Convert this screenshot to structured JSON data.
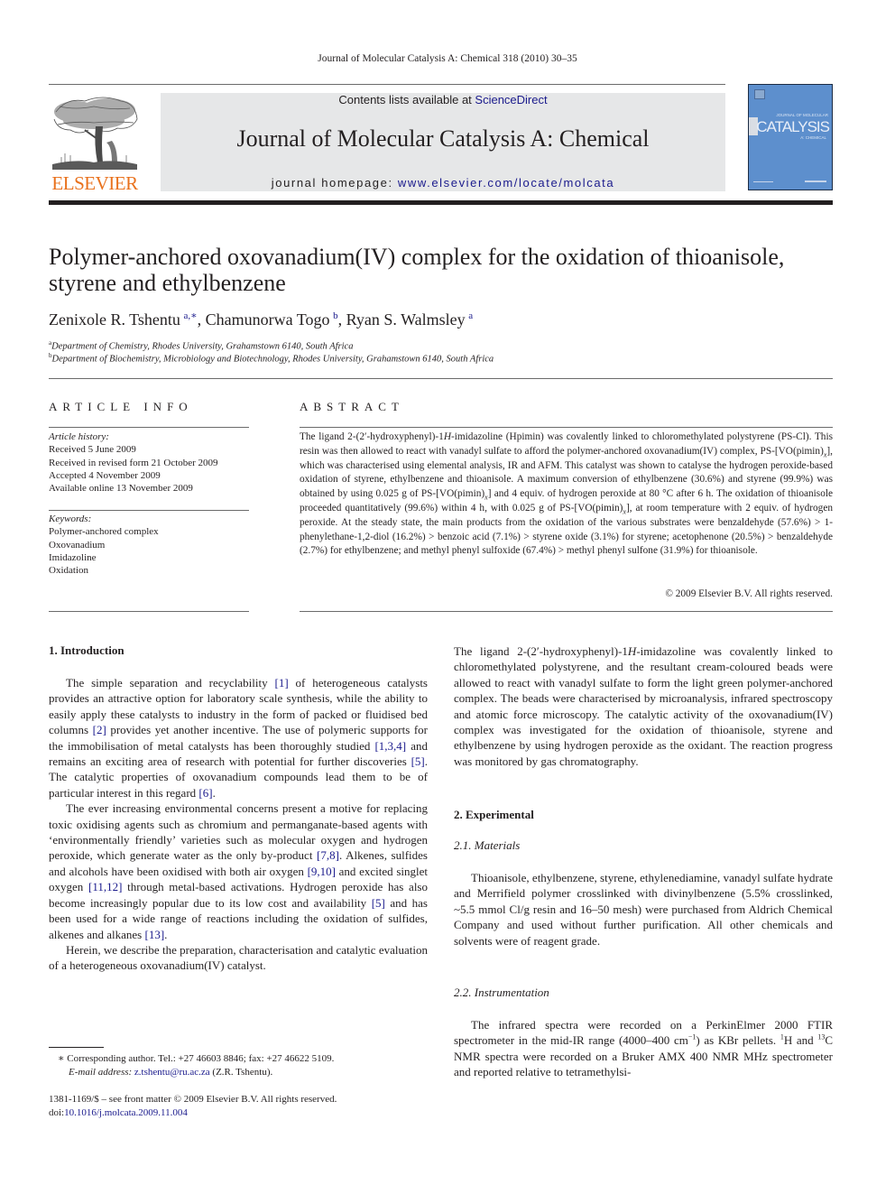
{
  "running_head": "Journal of Molecular Catalysis A: Chemical 318 (2010) 30–35",
  "masthead": {
    "publisher_logo": "ELSEVIER",
    "contents_prefix": "Contents lists available at ",
    "contents_link": "ScienceDirect",
    "journal_name": "Journal of Molecular Catalysis A: Chemical",
    "homepage_prefix": "journal homepage: ",
    "homepage_link": "www.elsevier.com/locate/molcata",
    "cover": {
      "small_top": "JOURNAL OF MOLECULAR",
      "title": "CATALYSIS",
      "subtitle": "A: CHEMICAL",
      "background_color": "#5d8fcd"
    },
    "logo_color": "#e9711c",
    "band_color": "#e6e7e8"
  },
  "article": {
    "title": "Polymer-anchored oxovanadium(IV) complex for the oxidation of thioanisole, styrene and ethylbenzene",
    "authors": [
      {
        "name": "Zenixole R. Tshentu",
        "marks": "a,∗"
      },
      {
        "name": "Chamunorwa Togo",
        "marks": "b"
      },
      {
        "name": "Ryan S. Walmsley",
        "marks": "a"
      }
    ],
    "affiliations": [
      {
        "mark": "a",
        "text": "Department of Chemistry, Rhodes University, Grahamstown 6140, South Africa"
      },
      {
        "mark": "b",
        "text": "Department of Biochemistry, Microbiology and Biotechnology, Rhodes University, Grahamstown 6140, South Africa"
      }
    ]
  },
  "article_info": {
    "heading": "ARTICLE INFO",
    "history_label": "Article history:",
    "history": [
      "Received 5 June 2009",
      "Received in revised form 21 October 2009",
      "Accepted 4 November 2009",
      "Available online 13 November 2009"
    ],
    "keywords_label": "Keywords:",
    "keywords": [
      "Polymer-anchored complex",
      "Oxovanadium",
      "Imidazoline",
      "Oxidation"
    ]
  },
  "abstract": {
    "heading": "ABSTRACT",
    "parts": {
      "p1": "The ligand 2-(2′-hydroxyphenyl)-1",
      "p1_italic": "H",
      "p2": "-imidazoline (Hpimin) was covalently linked to chloromethylated polystyrene (PS-Cl). This resin was then allowed to react with vanadyl sulfate to afford the polymer-anchored oxovanadium(IV) complex, PS-[VO(pimin)",
      "sub_x": "x",
      "p3": "], which was characterised using elemental analysis, IR and AFM. This catalyst was shown to catalyse the hydrogen peroxide-based oxidation of styrene, ethylbenzene and thioanisole. A maximum conversion of ethylbenzene (30.6%) and styrene (99.9%) was obtained by using 0.025 g of PS-[VO(pimin)",
      "p4": "] and 4 equiv. of hydrogen peroxide at 80 °C after 6 h. The oxidation of thioanisole proceeded quantitatively (99.6%) within 4 h, with 0.025 g of PS-[VO(pimin)",
      "p5": "], at room temperature with 2 equiv. of hydrogen peroxide. At the steady state, the main products from the oxidation of the various substrates were benzaldehyde (57.6%) > 1-phenylethane-1,2-diol (16.2%) > benzoic acid (7.1%) > styrene oxide (3.1%) for styrene; acetophenone (20.5%) > benzaldehyde (2.7%) for ethylbenzene; and methyl phenyl sulfoxide (67.4%) > methyl phenyl sulfone (31.9%) for thioanisole."
    },
    "copyright": "© 2009 Elsevier B.V. All rights reserved."
  },
  "introduction": {
    "heading": "1.  Introduction",
    "para1": [
      {
        "t": "The simple separation and recyclability "
      },
      {
        "ref": "[1]"
      },
      {
        "t": " of heterogeneous catalysts provides an attractive option for laboratory scale synthesis, while the ability to easily apply these catalysts to industry in the form of packed or fluidised bed columns "
      },
      {
        "ref": "[2]"
      },
      {
        "t": " provides yet another incentive. The use of polymeric supports for the immobilisation of metal catalysts has been thoroughly studied "
      },
      {
        "ref": "[1,3,4]"
      },
      {
        "t": " and remains an exciting area of research with potential for further discoveries "
      },
      {
        "ref": "[5]"
      },
      {
        "t": ". The catalytic properties of oxovanadium compounds lead them to be of particular interest in this regard "
      },
      {
        "ref": "[6]"
      },
      {
        "t": "."
      }
    ],
    "para2": [
      {
        "t": "The ever increasing environmental concerns present a motive for replacing toxic oxidising agents such as chromium and permanganate-based agents with ‘environmentally friendly’ varieties such as molecular oxygen and hydrogen peroxide, which generate water as the only by-product "
      },
      {
        "ref": "[7,8]"
      },
      {
        "t": ". Alkenes, sulfides and alcohols have been oxidised with both air oxygen "
      },
      {
        "ref": "[9,10]"
      },
      {
        "t": " and excited singlet oxygen "
      },
      {
        "ref": "[11,12]"
      },
      {
        "t": " through metal-based activations. Hydrogen peroxide has also become increasingly popular due to its low cost and availability "
      },
      {
        "ref": "[5]"
      },
      {
        "t": " and has been used for a wide range of reactions including the oxidation of sulfides, alkenes and alkanes "
      },
      {
        "ref": "[13]"
      },
      {
        "t": "."
      }
    ],
    "para3": "Herein, we describe the preparation, characterisation and catalytic evaluation of a heterogeneous oxovanadium(IV) catalyst.",
    "para4_a": "The ligand 2-(2′-hydroxyphenyl)-1",
    "para4_i": "H",
    "para4_b": "-imidazoline was covalently linked to chloromethylated polystyrene, and the resultant cream-coloured beads were allowed to react with vanadyl sulfate to form the light green polymer-anchored complex. The beads were characterised by microanalysis, infrared spectroscopy and atomic force microscopy. The catalytic activity of the oxovanadium(IV) complex was investigated for the oxidation of thioanisole, styrene and ethylbenzene by using hydrogen peroxide as the oxidant. The reaction progress was monitored by gas chromatography."
  },
  "experimental": {
    "heading": "2.  Experimental",
    "materials_heading": "2.1.  Materials",
    "materials_text": "Thioanisole, ethylbenzene, styrene, ethylenediamine, vanadyl sulfate hydrate and Merrifield polymer crosslinked with divinylbenzene (5.5% crosslinked, ~5.5 mmol Cl/g resin and 16–50 mesh) were purchased from Aldrich Chemical Company and used without further purification. All other chemicals and solvents were of reagent grade.",
    "instrumentation_heading": "2.2.  Instrumentation",
    "instr_a": "The infrared spectra were recorded on a PerkinElmer 2000 FTIR spectrometer in the mid-IR range (4000–400 cm",
    "instr_sup1": "−1",
    "instr_b": ") as KBr pellets. ",
    "instr_sup2": "1",
    "instr_c": "H and ",
    "instr_sup3": "13",
    "instr_d": "C NMR spectra were recorded on a Bruker AMX 400 NMR MHz spectrometer and reported relative to tetramethylsi-"
  },
  "footnotes": {
    "corresponding": "∗  Corresponding author. Tel.: +27 46603 8846; fax: +27 46622 5109.",
    "email_label": "E-mail address: ",
    "email": "z.tshentu@ru.ac.za",
    "email_suffix": " (Z.R. Tshentu).",
    "issn_line": "1381-1169/$ – see front matter © 2009 Elsevier B.V. All rights reserved.",
    "doi_prefix": "doi:",
    "doi": "10.1016/j.molcata.2009.11.004"
  }
}
